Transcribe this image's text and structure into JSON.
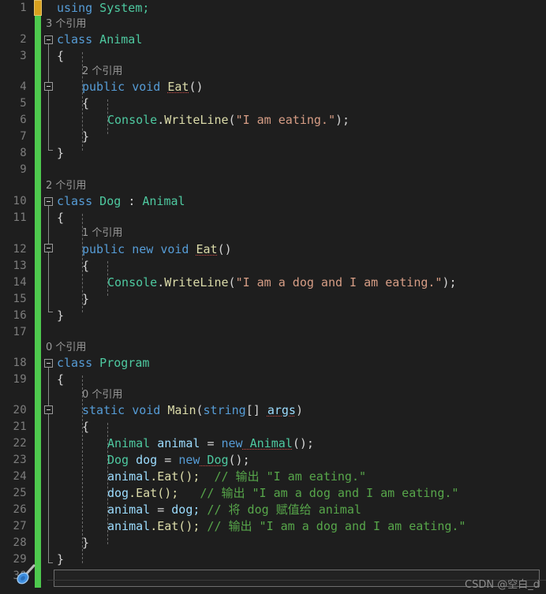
{
  "editor": {
    "theme": "dark",
    "background_color": "#1e1e1e",
    "language": "csharp",
    "gutter": {
      "line_numbers": [
        "1",
        "2",
        "3",
        "4",
        "5",
        "6",
        "7",
        "8",
        "9",
        "10",
        "11",
        "12",
        "13",
        "14",
        "15",
        "16",
        "17",
        "18",
        "19",
        "20",
        "21",
        "22",
        "23",
        "24",
        "25",
        "26",
        "27",
        "28",
        "29",
        "30"
      ],
      "line_number_color": "#7d7d7d",
      "change_bar_color": "#4ec94e",
      "edit_marker_color": "#d8a01e"
    },
    "colors": {
      "keyword": "#569cd6",
      "type": "#4ec9a0",
      "method": "#dcdcaa",
      "string": "#d69d85",
      "comment": "#57a64a",
      "local_variable": "#9cdcfe",
      "punctuation": "#d4d4d4",
      "codelens": "#9a9a9a",
      "error_squiggle": "#d1504a"
    },
    "codelens": {
      "animal_class": "3 个引用",
      "animal_eat": "2 个引用",
      "dog_class": "2 个引用",
      "dog_eat": "1 个引用",
      "program_class": "0 个引用",
      "program_main": "0 个引用"
    },
    "lines": {
      "l1_using": "using",
      "l1_system": " System;",
      "l2_class": "class",
      "l2_name": " Animal",
      "l3_brace": "{",
      "l4_public": "public",
      "l4_void": " void ",
      "l4_eat": "Eat",
      "l4_parens": "()",
      "l5_brace": "{",
      "l6_console": "Console",
      "l6_dot": ".",
      "l6_writeline": "WriteLine",
      "l6_open": "(",
      "l6_string": "\"I am eating.\"",
      "l6_close": ");",
      "l7_brace": "}",
      "l8_brace": "}",
      "l10_class": "class",
      "l10_dog": " Dog ",
      "l10_colon": ": ",
      "l10_animal": "Animal",
      "l11_brace": "{",
      "l12_public": "public",
      "l12_new": " new",
      "l12_void": " void ",
      "l12_eat": "Eat",
      "l12_parens": "()",
      "l13_brace": "{",
      "l14_console": "Console",
      "l14_dot": ".",
      "l14_writeline": "WriteLine",
      "l14_open": "(",
      "l14_string": "\"I am a dog and I am eating.\"",
      "l14_close": ");",
      "l15_brace": "}",
      "l16_brace": "}",
      "l18_class": "class",
      "l18_name": " Program",
      "l19_brace": "{",
      "l20_static": "static",
      "l20_void": " void ",
      "l20_main": "Main",
      "l20_open": "(",
      "l20_string_t": "string",
      "l20_brackets": "[] ",
      "l20_args": "args",
      "l20_close": ")",
      "l21_brace": "{",
      "l22_type": "Animal",
      "l22_var": " animal ",
      "l22_eq": "= ",
      "l22_new": "new",
      "l22_ctor": " Animal",
      "l22_end": "();",
      "l23_type": "Dog",
      "l23_var": " dog ",
      "l23_eq": "= ",
      "l23_new": "new",
      "l23_ctor": " Dog",
      "l23_end": "();",
      "l24_var": "animal",
      "l24_call": ".Eat();",
      "l24_comment": "  // 输出 \"I am eating.\"",
      "l25_var": "dog",
      "l25_call": ".Eat();",
      "l25_comment": "   // 输出 \"I am a dog and I am eating.\"",
      "l26_var": "animal ",
      "l26_eq": "= ",
      "l26_val": "dog;",
      "l26_comment": " // 将 dog 赋值给 animal",
      "l27_var": "animal",
      "l27_call": ".Eat();",
      "l27_comment": " // 输出 \"I am a dog and I am eating.\"",
      "l28_brace": "}",
      "l29_brace": "}"
    }
  },
  "watermark": {
    "text": "CSDN @空白_d"
  }
}
